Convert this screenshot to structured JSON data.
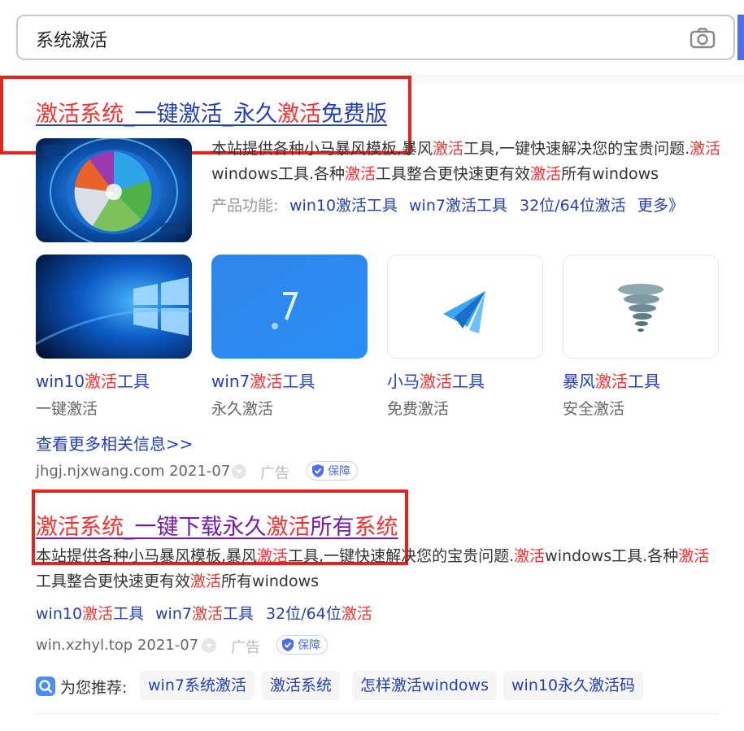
{
  "search": {
    "query": "系统激活",
    "camera_icon": "camera-icon"
  },
  "result1": {
    "title_parts": [
      {
        "text": "激活系统",
        "hl": true
      },
      {
        "text": "_一键激活_永久",
        "hl": false
      },
      {
        "text": "激活",
        "hl": true
      },
      {
        "text": "免费版",
        "hl": false
      }
    ],
    "desc_parts": [
      {
        "text": "本站提供各种小马暴风模板,暴风",
        "hl": false
      },
      {
        "text": "激活",
        "hl": true
      },
      {
        "text": "工具,一键快速解决您的宝贵问题.",
        "hl": false
      },
      {
        "text": "激活",
        "hl": true
      },
      {
        "text": "windows工具.各种",
        "hl": false
      },
      {
        "text": "激活",
        "hl": true
      },
      {
        "text": "工具整合更快速更有效",
        "hl": false
      },
      {
        "text": "激活",
        "hl": true
      },
      {
        "text": "所有windows",
        "hl": false
      }
    ],
    "features_label": "产品功能:",
    "features": [
      "win10激活工具",
      "win7激活工具",
      "32位/64位激活",
      "更多》"
    ],
    "cards": [
      {
        "title_a": "win10",
        "title_hl": "激活",
        "title_b": "工具",
        "sub": "一键激活"
      },
      {
        "title_a": "win7",
        "title_hl": "激活",
        "title_b": "工具",
        "sub": "永久激活"
      },
      {
        "title_a": "小马",
        "title_hl": "激活",
        "title_b": "工具",
        "sub": "免费激活"
      },
      {
        "title_a": "暴风",
        "title_hl": "激活",
        "title_b": "工具",
        "sub": "安全激活"
      }
    ],
    "more_link": "查看更多相关信息>>",
    "source": "jhgj.njxwang.com 2021-07",
    "ad": "广告",
    "badge": "保障"
  },
  "result2": {
    "title_parts": [
      {
        "text": "激活系统",
        "hl": true
      },
      {
        "text": "_一键下载永久",
        "hl": false
      },
      {
        "text": "激活",
        "hl": true
      },
      {
        "text": "所有",
        "hl": false
      },
      {
        "text": "系统",
        "hl": true
      }
    ],
    "desc_parts": [
      {
        "text": "本站提供各种小马暴风模板,暴风",
        "hl": false
      },
      {
        "text": "激活",
        "hl": true
      },
      {
        "text": "工具,一键快速解决您的宝贵问题.",
        "hl": false
      },
      {
        "text": "激活",
        "hl": true
      },
      {
        "text": "windows工具.各种",
        "hl": false
      },
      {
        "text": "激活",
        "hl": true
      },
      {
        "text": "工具整合更快速更有效",
        "hl": false
      },
      {
        "text": "激活",
        "hl": true
      },
      {
        "text": "所有windows",
        "hl": false
      }
    ],
    "links": [
      {
        "a": "win10",
        "hl": "激活",
        "b": "工具"
      },
      {
        "a": "win7",
        "hl": "激活",
        "b": "工具"
      },
      {
        "a": "32位/64位",
        "hl": "激活",
        "b": ""
      }
    ],
    "source": "win.xzhyl.top 2021-07",
    "ad": "广告",
    "badge": "保障"
  },
  "recommend": {
    "label": "为您推荐:",
    "chips": [
      "win7系统激活",
      "激活系统",
      "怎样激活windows",
      "win10永久激活码"
    ]
  },
  "colors": {
    "highlight": "#f73131",
    "link": "#2440b3",
    "visited": "#771caa",
    "box": "#e8231d",
    "accent": "#4e6ef2"
  }
}
